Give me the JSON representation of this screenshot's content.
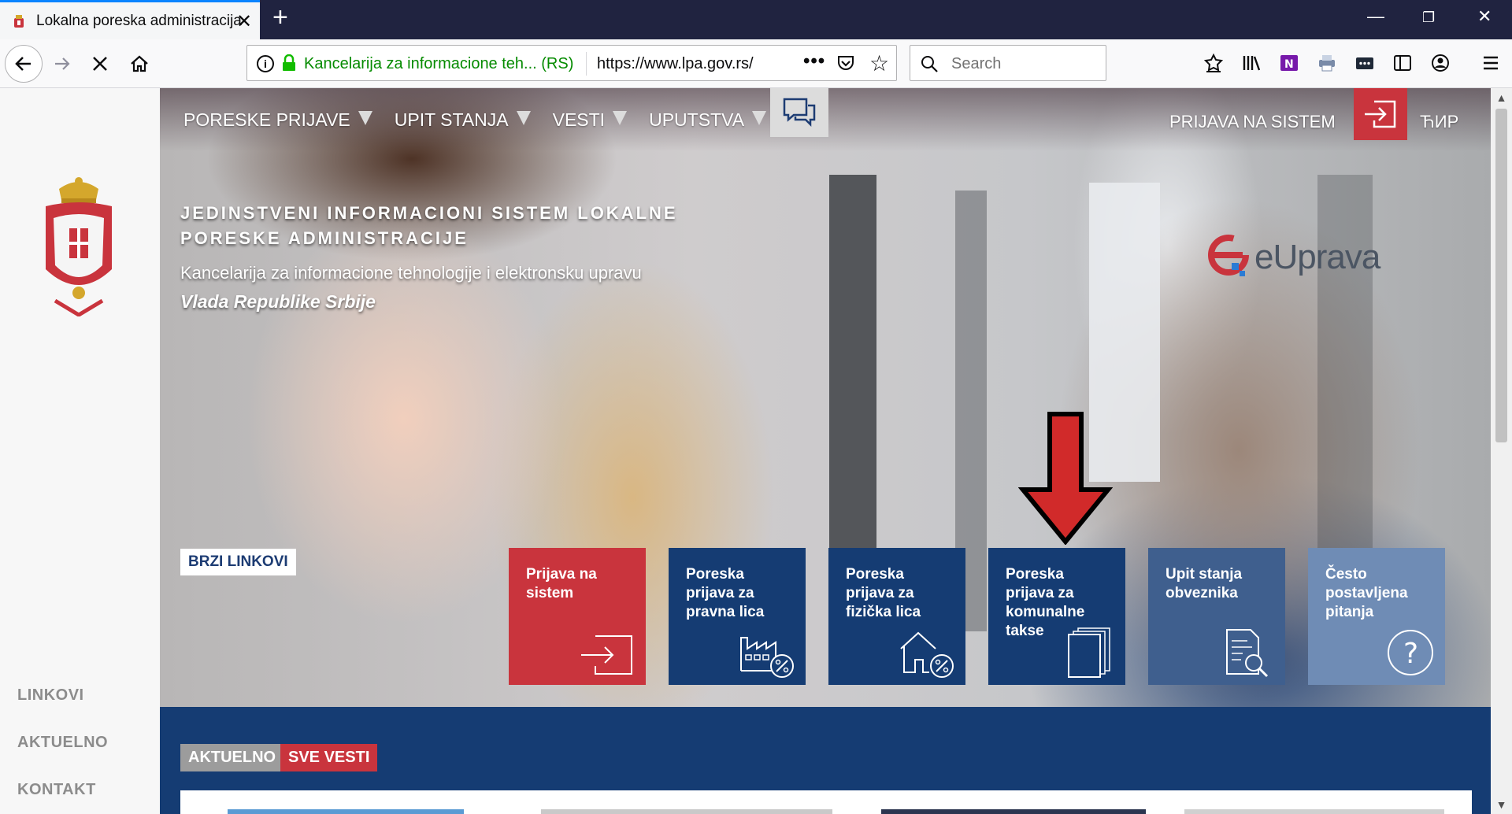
{
  "browser": {
    "tab_title": "Lokalna poreska administracija",
    "tab_close": "✕",
    "new_tab": "+",
    "identity_label": "Kancelarija za informacione teh... (RS)",
    "url": "https://www.lpa.gov.rs/",
    "page_actions": "•••",
    "search_placeholder": "Search",
    "window_controls": {
      "minimize": "—",
      "restore": "❐",
      "close": "✕"
    }
  },
  "site": {
    "menu": [
      {
        "label": "PORESKE PRIJAVE"
      },
      {
        "label": "UPIT STANJA"
      },
      {
        "label": "VESTI"
      },
      {
        "label": "UPUTSTVA"
      }
    ],
    "login_label": "PRIJAVA NA SISTEM",
    "language_label": "ЋИР",
    "hero": {
      "title": "JEDINSTVENI INFORMACIONI SISTEM LOKALNE PORESKE ADMINISTRACIJE",
      "subtitle": "Kancelarija za informacione tehnologije i elektronsku upravu",
      "government": "Vlada Republike Srbije"
    },
    "euprava_logo_text": "eUprava",
    "quick_links_label": "BRZI LINKOVI",
    "tiles": [
      {
        "label": "Prijava na sistem",
        "icon": "login-icon",
        "color": "#c9343d"
      },
      {
        "label": "Poreska prijava za pravna lica",
        "icon": "factory-percent-icon",
        "color": "#153c73"
      },
      {
        "label": "Poreska prijava za fizička lica",
        "icon": "house-percent-icon",
        "color": "#153c73"
      },
      {
        "label": "Poreska prijava za komunalne takse",
        "icon": "documents-stack-icon",
        "color": "#153c73"
      },
      {
        "label": "Upit stanja obveznika",
        "icon": "document-search-icon",
        "color": "#3f5f8e"
      },
      {
        "label": "Često postavljena pitanja",
        "icon": "question-circle-icon",
        "color": "#6f8cb5"
      }
    ],
    "sidebar_links": [
      "LINKOVI",
      "AKTUELNO",
      "KONTAKT"
    ],
    "news": {
      "tab_active": "AKTUELNO",
      "tab_all": "SVE VESTI"
    }
  },
  "colors": {
    "navy": "#153c73",
    "red": "#c9343d",
    "firefox_dark": "#202340"
  }
}
